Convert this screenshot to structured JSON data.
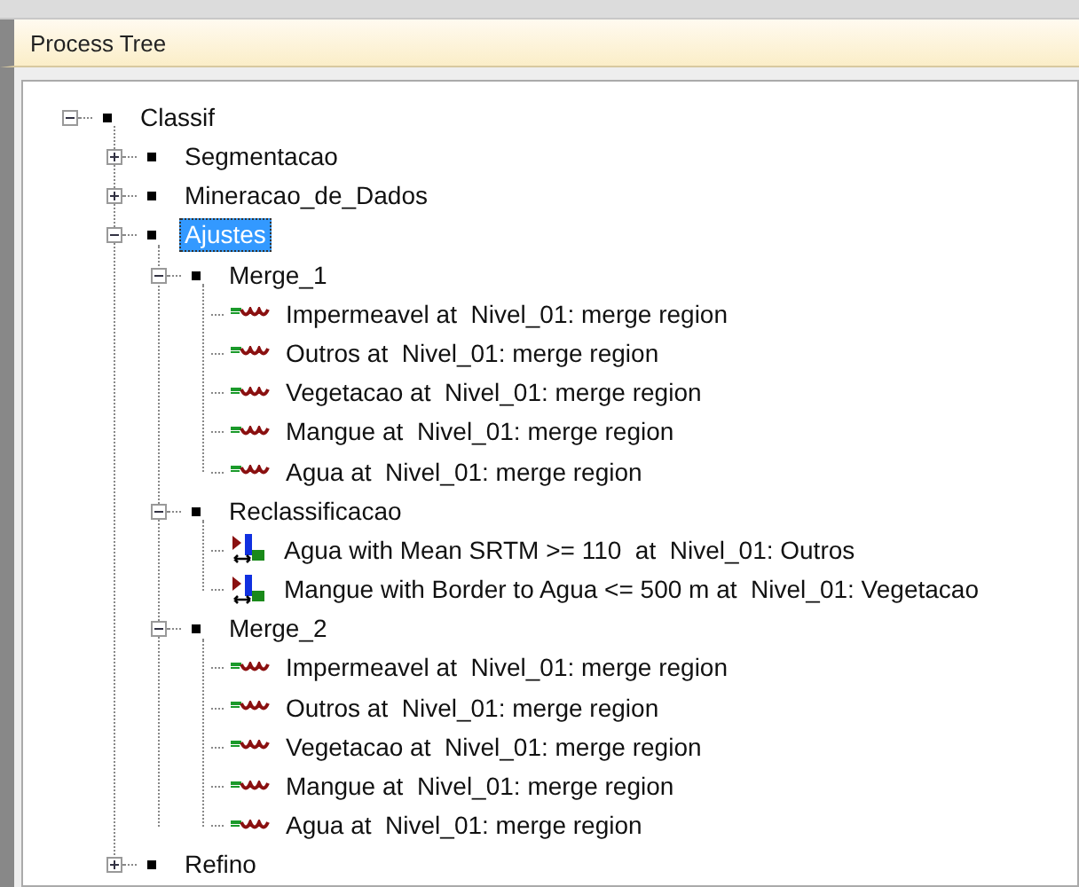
{
  "panel": {
    "title": "Process Tree"
  },
  "tree": [
    {
      "kind": "folder",
      "label": "Classif",
      "expanded": true,
      "selected": false,
      "children": [
        {
          "kind": "folder",
          "label": "Segmentacao",
          "expanded": false,
          "selected": false
        },
        {
          "kind": "folder",
          "label": "Mineracao_de_Dados",
          "expanded": false,
          "selected": false
        },
        {
          "kind": "folder",
          "label": "Ajustes",
          "expanded": true,
          "selected": true,
          "children": [
            {
              "kind": "folder",
              "label": "Merge_1",
              "expanded": true,
              "selected": false,
              "children": [
                {
                  "kind": "merge",
                  "label": "Impermeavel at  Nivel_01: merge region",
                  "selected": false
                },
                {
                  "kind": "merge",
                  "label": "Outros at  Nivel_01: merge region",
                  "selected": false
                },
                {
                  "kind": "merge",
                  "label": "Vegetacao at  Nivel_01: merge region",
                  "selected": false
                },
                {
                  "kind": "merge",
                  "label": "Mangue at  Nivel_01: merge region",
                  "selected": false
                },
                {
                  "kind": "merge",
                  "label": "Agua at  Nivel_01: merge region",
                  "selected": false
                }
              ]
            },
            {
              "kind": "folder",
              "label": "Reclassificacao",
              "expanded": true,
              "selected": false,
              "children": [
                {
                  "kind": "classify",
                  "label": "Agua with Mean SRTM >= 110  at  Nivel_01: Outros",
                  "selected": false
                },
                {
                  "kind": "classify",
                  "label": "Mangue with Border to Agua <= 500 m at  Nivel_01: Vegetacao",
                  "selected": false
                }
              ]
            },
            {
              "kind": "folder",
              "label": "Merge_2",
              "expanded": true,
              "selected": false,
              "children": [
                {
                  "kind": "merge",
                  "label": "Impermeavel at  Nivel_01: merge region",
                  "selected": false
                },
                {
                  "kind": "merge",
                  "label": "Outros at  Nivel_01: merge region",
                  "selected": false
                },
                {
                  "kind": "merge",
                  "label": "Vegetacao at  Nivel_01: merge region",
                  "selected": false
                },
                {
                  "kind": "merge",
                  "label": "Mangue at  Nivel_01: merge region",
                  "selected": false
                },
                {
                  "kind": "merge",
                  "label": "Agua at  Nivel_01: merge region",
                  "selected": false
                }
              ]
            }
          ]
        },
        {
          "kind": "folder",
          "label": "Refino",
          "expanded": false,
          "selected": false
        }
      ]
    }
  ]
}
